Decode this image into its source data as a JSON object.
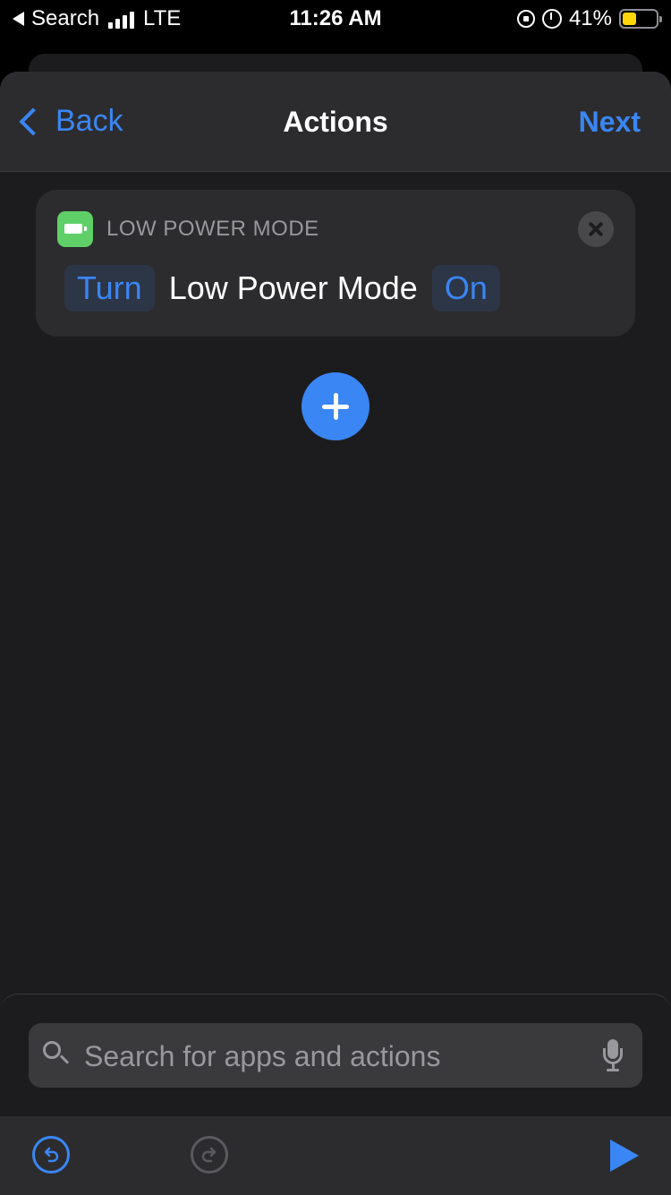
{
  "status_bar": {
    "back_label": "Search",
    "carrier": "LTE",
    "time": "11:26 AM",
    "battery_percent": "41%",
    "battery_level": 0.41
  },
  "nav": {
    "back_label": "Back",
    "title": "Actions",
    "next_label": "Next"
  },
  "action_card": {
    "category": "LOW POWER MODE",
    "verb_token": "Turn",
    "target": "Low Power Mode",
    "state_token": "On",
    "icon": "battery-icon"
  },
  "search": {
    "placeholder": "Search for apps and actions"
  },
  "toolbar": {
    "undo_icon": "undo-icon",
    "redo_icon": "redo-icon",
    "play_icon": "play-icon"
  },
  "colors": {
    "accent": "#3a86f4",
    "background": "#1c1c1e",
    "battery_icon": "#5fd068"
  }
}
